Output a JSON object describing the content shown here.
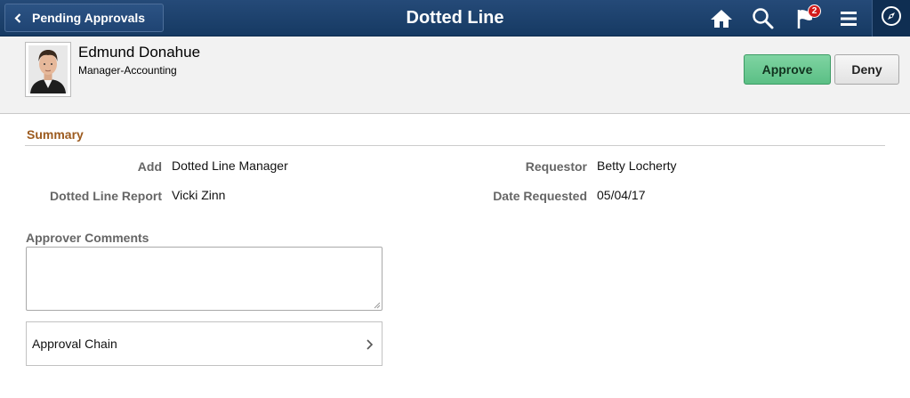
{
  "banner": {
    "back_label": "Pending Approvals",
    "title": "Dotted Line",
    "icons": [
      "home-icon",
      "search-icon",
      "notifications-flag-icon",
      "actions-menu-icon",
      "navbar-compass-icon"
    ],
    "notification_count": "2"
  },
  "employee": {
    "name": "Edmund Donahue",
    "title": "Manager-Accounting"
  },
  "actions": {
    "approve_label": "Approve",
    "deny_label": "Deny"
  },
  "summary": {
    "heading": "Summary",
    "fields": [
      {
        "label": "Add",
        "value": "Dotted Line Manager"
      },
      {
        "label": "Requestor",
        "value": "Betty Locherty"
      },
      {
        "label": "Dotted Line Report",
        "value": "Vicki Zinn"
      },
      {
        "label": "Date Requested",
        "value": "05/04/17"
      }
    ]
  },
  "comments": {
    "label": "Approver Comments",
    "value": ""
  },
  "approval_chain": {
    "label": "Approval Chain"
  },
  "colors": {
    "banner": "#1f4473",
    "approve": "#6cc893",
    "summary_heading": "#9c5a1e"
  }
}
